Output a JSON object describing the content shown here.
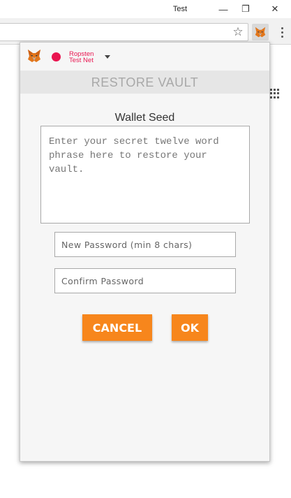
{
  "window": {
    "profile_name": "Test",
    "minimize_glyph": "—",
    "restore_glyph": "❐",
    "close_glyph": "✕"
  },
  "toolbar": {
    "star_icon": "bookmark-star-icon",
    "extension_icon": "metamask-fox-icon",
    "menu_icon": "kebab-menu-icon",
    "apps_icon": "apps-grid-icon"
  },
  "popup": {
    "network": {
      "line1": "Ropsten",
      "line2": "Test Net",
      "dot_color": "#e91550"
    },
    "title": "RESTORE VAULT",
    "seed_label": "Wallet Seed",
    "seed_placeholder": "Enter your secret twelve word phrase here to restore your vault.",
    "new_password_placeholder": "New Password (min 8 chars)",
    "confirm_password_placeholder": "Confirm Password",
    "cancel_label": "CANCEL",
    "ok_label": "OK",
    "accent_color": "#f7861c"
  }
}
